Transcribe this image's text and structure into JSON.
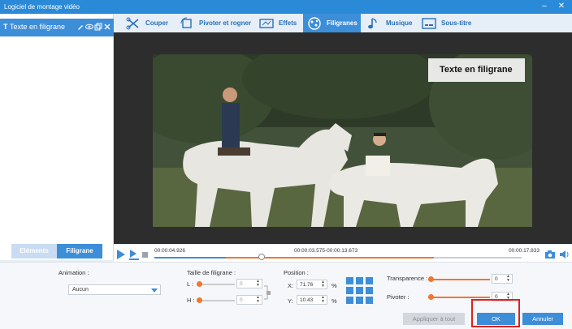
{
  "window": {
    "title": "Logiciel de montage vidéo"
  },
  "tabs": [
    {
      "label": "Couper",
      "icon": "scissors-icon"
    },
    {
      "label": "Pivoter et rogner",
      "icon": "rotate-crop-icon"
    },
    {
      "label": "Effets",
      "icon": "effects-icon"
    },
    {
      "label": "Filigranes",
      "icon": "watermark-icon"
    },
    {
      "label": "Musique",
      "icon": "music-icon"
    },
    {
      "label": "Sous-titre",
      "icon": "subtitle-icon"
    }
  ],
  "sidebar": {
    "item_prefix": "T",
    "item_label": "Texte en filigrane",
    "tab_elements": "Eléments",
    "tab_watermark": "Filigrane"
  },
  "preview": {
    "watermark_text": "Texte en filigrane"
  },
  "timeline": {
    "start": "00:00:04.926",
    "selection": "00:00:03.575-00:00:13.673",
    "end": "00:00:17.833"
  },
  "settings": {
    "animation_label": "Animation :",
    "animation_value": "Aucun",
    "size_label": "Taille de filigrane :",
    "width_label": "L :",
    "width_value": "0",
    "height_label": "H :",
    "height_value": "0",
    "position_label": "Position :",
    "x_label": "X:",
    "x_value": "71.76",
    "x_unit": "%",
    "y_label": "Y:",
    "y_value": "10.43",
    "y_unit": "%",
    "transparency_label": "Transparence :",
    "transparency_value": "0",
    "rotate_label": "Pivoter :",
    "rotate_value": "0"
  },
  "buttons": {
    "apply_all": "Appliquer à tout",
    "ok": "OK",
    "cancel": "Annuler"
  },
  "colors": {
    "accent": "#3d8ed9",
    "titlebar": "#2a8ad8",
    "highlight": "#f0772f",
    "ok_frame": "#e02020"
  }
}
